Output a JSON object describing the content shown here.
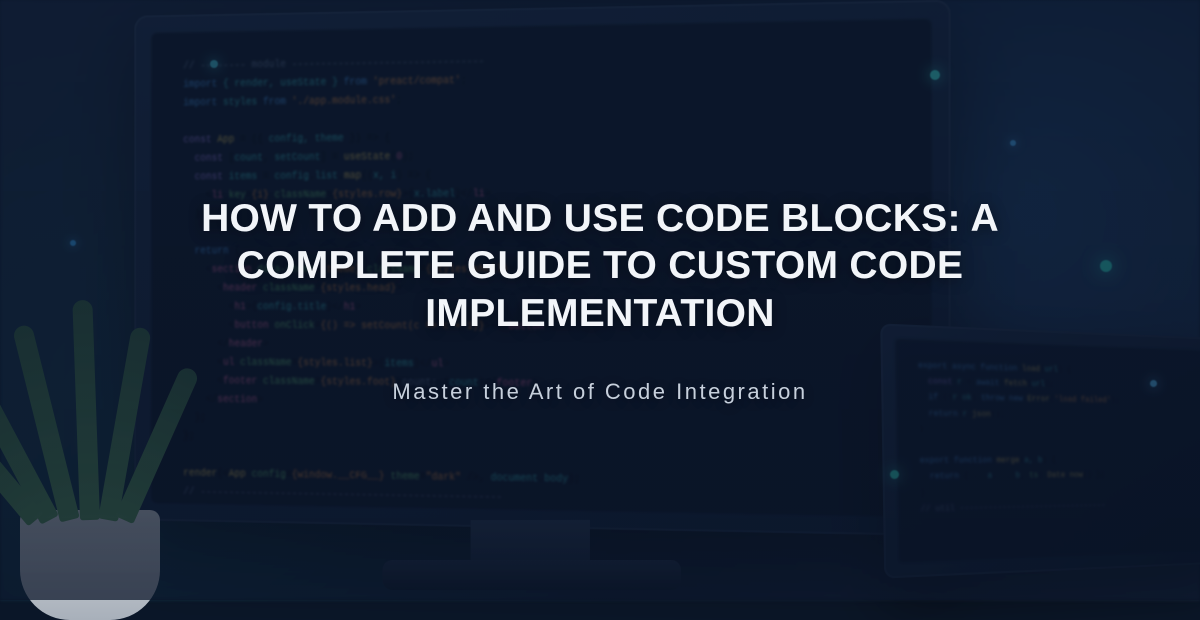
{
  "hero": {
    "title": "HOW TO ADD AND USE CODE BLOCKS: A COMPLETE GUIDE TO CUSTOM CODE IMPLEMENTATION",
    "subtitle": "Master the Art of Code Integration"
  },
  "colors": {
    "overlay": "rgba(12,24,46,0.70)",
    "title_text": "#f2f5f9",
    "subtitle_text": "#c7d0dc"
  }
}
